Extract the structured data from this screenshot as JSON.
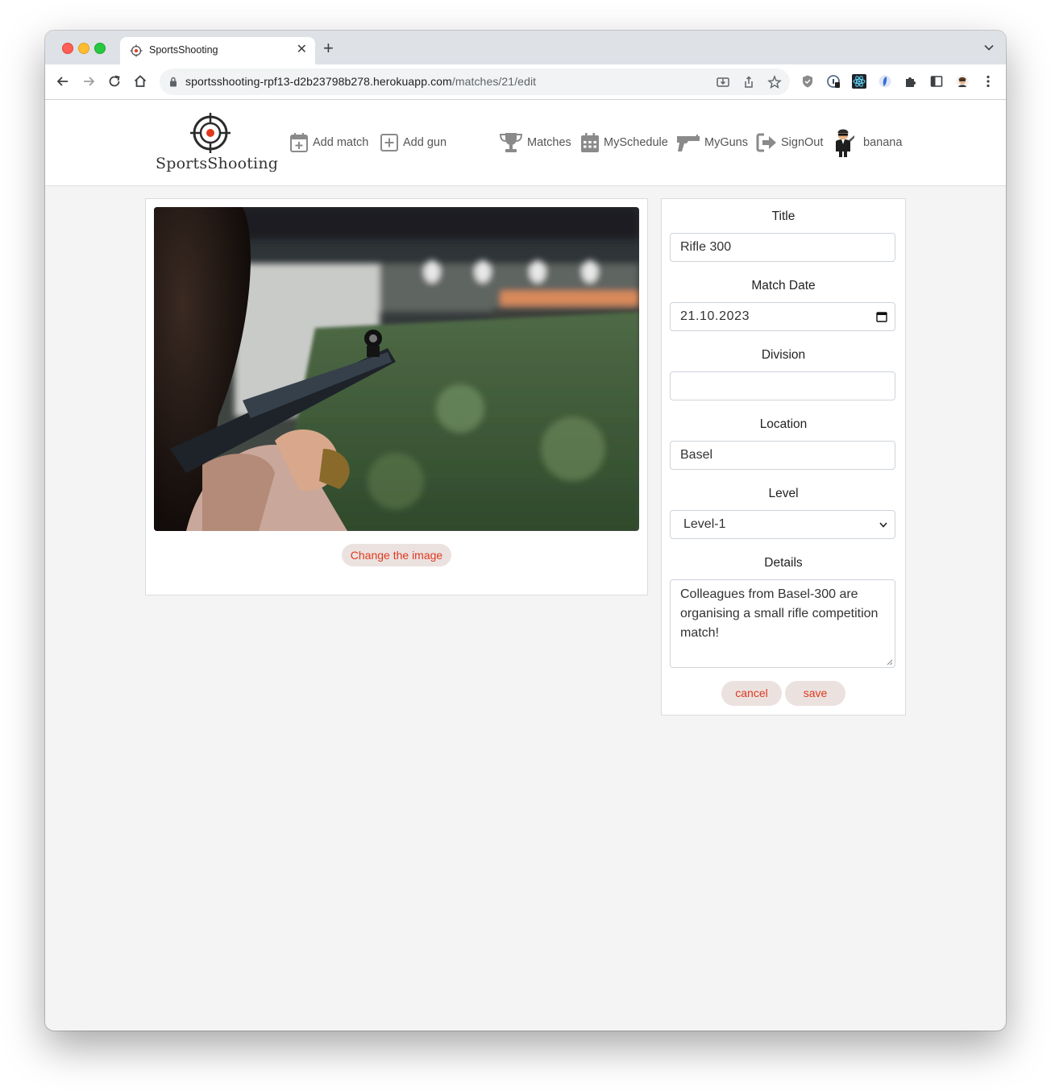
{
  "browser": {
    "tab_title": "SportsShooting",
    "new_tab": "+",
    "url_host": "sportsshooting-rpf13-d2b23798b278.herokuapp.com",
    "url_path": "/matches/21/edit"
  },
  "nav": {
    "logo_text": "SportsShooting",
    "add_match": "Add match",
    "add_gun": "Add gun",
    "matches": "Matches",
    "my_schedule": "MySchedule",
    "my_guns": "MyGuns",
    "sign_out": "SignOut",
    "username": "banana"
  },
  "image_card": {
    "change_image_label": "Change the image"
  },
  "form": {
    "title_label": "Title",
    "title_value": "Rifle 300",
    "date_label": "Match Date",
    "date_value": "21.10.2023",
    "division_label": "Division",
    "division_value": "",
    "location_label": "Location",
    "location_value": "Basel",
    "level_label": "Level",
    "level_value": "Level-1",
    "details_label": "Details",
    "details_value": "Colleagues from Basel-300 are organising a small rifle competition match!",
    "cancel_label": "cancel",
    "save_label": "save"
  },
  "colors": {
    "accent": "#e0381d",
    "pill_bg": "#ebe2e0",
    "page_bg": "#f4f4f4",
    "icon_gray": "#8a8a8a"
  }
}
